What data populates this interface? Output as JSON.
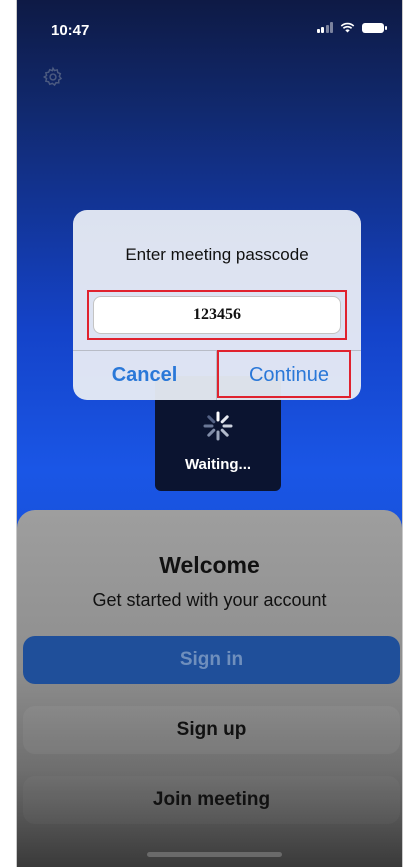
{
  "status_bar": {
    "time": "10:47"
  },
  "icons": {
    "settings": "gear-icon",
    "signal": "signal-icon",
    "wifi": "wifi-icon",
    "battery": "battery-icon",
    "spinner": "loading-spinner-icon"
  },
  "waiting": {
    "label": "Waiting..."
  },
  "dialog": {
    "title": "Enter meeting passcode",
    "passcode_value": "123456",
    "cancel_label": "Cancel",
    "continue_label": "Continue"
  },
  "sheet": {
    "title": "Welcome",
    "subtitle": "Get started with your account",
    "sign_in_label": "Sign in",
    "sign_up_label": "Sign up",
    "join_label": "Join meeting"
  },
  "colors": {
    "accent": "#2a78d8",
    "highlight_outline": "#e0222e",
    "sign_in_button": "#1f4f9a"
  }
}
